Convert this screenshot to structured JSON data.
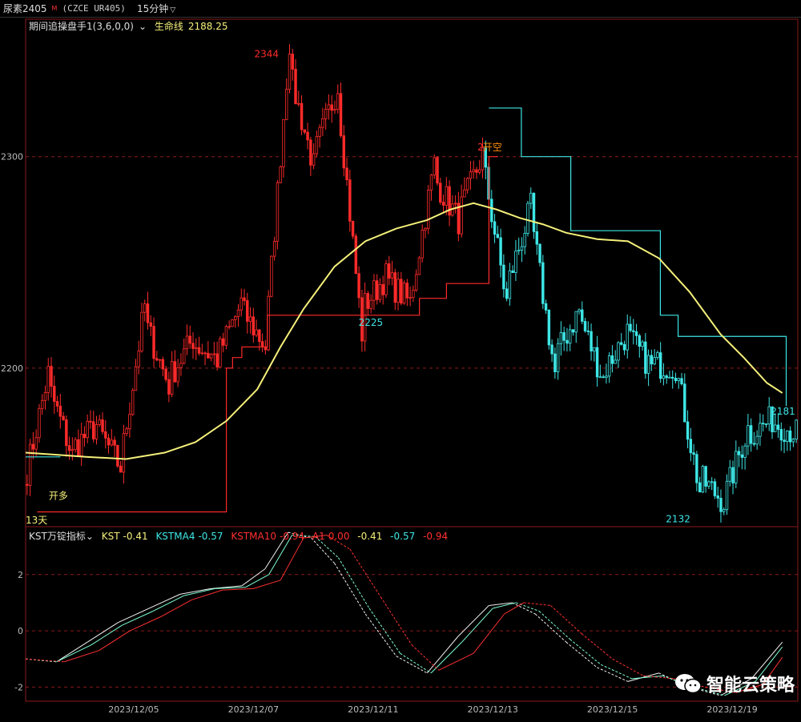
{
  "header": {
    "symbol": "尿素2405",
    "main_flag": "M",
    "code": "(CZCE UR405)",
    "period": "15分钟"
  },
  "main_legend": {
    "indicator": "期间追操盘手1(3,6,0,0)",
    "line_label": "生命线",
    "line_value": "2188.25"
  },
  "sub_legend": {
    "indicator": "KST万锭指标",
    "kst_label": "KST",
    "kst_value": "-0.41",
    "kstma4_label": "KSTMA4",
    "kstma4_value": "-0.57",
    "kstma10_label": "KSTMA10",
    "kstma10_value": "-0.94",
    "a1_label": "A1",
    "a1_value": "0.00",
    "v1": "-0.41",
    "v2": "-0.57",
    "v3": "-0.94"
  },
  "annotations": {
    "high": "2344",
    "mid_low": "2225",
    "peak2": "2",
    "open_short": "开空",
    "low": "2132",
    "last": "2181",
    "open_long": "开多",
    "days": "13天"
  },
  "watermark": "智能云策略",
  "colors": {
    "up": "#ff2a2a",
    "down": "#3ee6e6",
    "life_line": "#f5f07a",
    "kst": "#f0f0f0",
    "kstma4": "#7fffd4",
    "kstma10": "#ff3030",
    "grid": "#8b1a1a"
  },
  "chart_data": [
    {
      "type": "candlestick",
      "y_ticks": [
        2300,
        2200
      ],
      "ylim": [
        2125,
        2365
      ],
      "x_tick_labels": [
        "2023/12/05",
        "2023/12/07",
        "2023/12/11",
        "2023/12/13",
        "2023/12/15",
        "2023/12/19"
      ],
      "segments": [
        {
          "from": 2145,
          "to": 2192,
          "dir": "up"
        },
        {
          "from": 2192,
          "to": 2162,
          "dir": "up"
        },
        {
          "from": 2162,
          "to": 2172,
          "dir": "up"
        },
        {
          "from": 2172,
          "to": 2155,
          "dir": "up"
        },
        {
          "from": 2155,
          "to": 2222,
          "dir": "up"
        },
        {
          "from": 2222,
          "to": 2195,
          "dir": "up"
        },
        {
          "from": 2195,
          "to": 2212,
          "dir": "up"
        },
        {
          "from": 2212,
          "to": 2205,
          "dir": "up"
        },
        {
          "from": 2205,
          "to": 2228,
          "dir": "up"
        },
        {
          "from": 2228,
          "to": 2212,
          "dir": "up"
        },
        {
          "from": 2212,
          "to": 2340,
          "dir": "up"
        },
        {
          "from": 2340,
          "to": 2300,
          "dir": "up"
        },
        {
          "from": 2300,
          "to": 2330,
          "dir": "up"
        },
        {
          "from": 2330,
          "to": 2228,
          "dir": "up"
        },
        {
          "from": 2228,
          "to": 2242,
          "dir": "up"
        },
        {
          "from": 2242,
          "to": 2232,
          "dir": "up"
        },
        {
          "from": 2232,
          "to": 2290,
          "dir": "up"
        },
        {
          "from": 2290,
          "to": 2272,
          "dir": "up"
        },
        {
          "from": 2272,
          "to": 2298,
          "dir": "up"
        },
        {
          "from": 2298,
          "to": 2238,
          "dir": "down"
        },
        {
          "from": 2238,
          "to": 2272,
          "dir": "down"
        },
        {
          "from": 2272,
          "to": 2205,
          "dir": "down"
        },
        {
          "from": 2205,
          "to": 2225,
          "dir": "down"
        },
        {
          "from": 2225,
          "to": 2198,
          "dir": "down"
        },
        {
          "from": 2198,
          "to": 2215,
          "dir": "down"
        },
        {
          "from": 2215,
          "to": 2202,
          "dir": "down"
        },
        {
          "from": 2202,
          "to": 2201,
          "dir": "down"
        },
        {
          "from": 2201,
          "to": 2148,
          "dir": "down"
        },
        {
          "from": 2148,
          "to": 2138,
          "dir": "down"
        },
        {
          "from": 2138,
          "to": 2168,
          "dir": "down"
        },
        {
          "from": 2168,
          "to": 2175,
          "dir": "down"
        },
        {
          "from": 2175,
          "to": 2170,
          "dir": "down"
        }
      ],
      "life_line": [
        [
          0,
          2160
        ],
        [
          0.04,
          2159
        ],
        [
          0.08,
          2158
        ],
        [
          0.13,
          2157
        ],
        [
          0.18,
          2160
        ],
        [
          0.22,
          2165
        ],
        [
          0.26,
          2175
        ],
        [
          0.3,
          2190
        ],
        [
          0.33,
          2210
        ],
        [
          0.36,
          2228
        ],
        [
          0.4,
          2248
        ],
        [
          0.44,
          2260
        ],
        [
          0.48,
          2266
        ],
        [
          0.52,
          2270
        ],
        [
          0.55,
          2275
        ],
        [
          0.58,
          2278
        ],
        [
          0.61,
          2275
        ],
        [
          0.64,
          2271
        ],
        [
          0.67,
          2268
        ],
        [
          0.7,
          2264
        ],
        [
          0.74,
          2261
        ],
        [
          0.78,
          2260
        ],
        [
          0.82,
          2252
        ],
        [
          0.86,
          2236
        ],
        [
          0.9,
          2216
        ],
        [
          0.93,
          2205
        ],
        [
          0.96,
          2193
        ],
        [
          0.98,
          2188.25
        ]
      ],
      "red_step": [
        [
          0.015,
          2132
        ],
        [
          0.26,
          2132
        ],
        [
          0.26,
          2200
        ],
        [
          0.268,
          2200
        ],
        [
          0.268,
          2205
        ],
        [
          0.28,
          2205
        ],
        [
          0.28,
          2210
        ],
        [
          0.313,
          2210
        ],
        [
          0.313,
          2225
        ],
        [
          0.51,
          2225
        ],
        [
          0.51,
          2233
        ],
        [
          0.545,
          2233
        ],
        [
          0.545,
          2240
        ],
        [
          0.6,
          2240
        ],
        [
          0.6,
          2300
        ],
        [
          0.612,
          2300
        ]
      ],
      "cyan_step": [
        [
          0.6,
          2323
        ],
        [
          0.642,
          2323
        ],
        [
          0.642,
          2300
        ],
        [
          0.706,
          2300
        ],
        [
          0.706,
          2265
        ],
        [
          0.822,
          2265
        ],
        [
          0.822,
          2225
        ],
        [
          0.845,
          2225
        ],
        [
          0.845,
          2215
        ],
        [
          0.985,
          2215
        ],
        [
          0.985,
          2182
        ]
      ],
      "initial_cyan_step": [
        [
          0.0,
          2158
        ],
        [
          0.045,
          2158
        ]
      ]
    },
    {
      "type": "line",
      "y_ticks": [
        2,
        0,
        -2
      ],
      "ylim": [
        -2.5,
        3.7
      ],
      "series": [
        {
          "name": "KST",
          "values": [
            [
              0,
              -1.0
            ],
            [
              0.04,
              -1.1
            ],
            [
              0.08,
              -0.4
            ],
            [
              0.12,
              0.3
            ],
            [
              0.16,
              0.8
            ],
            [
              0.2,
              1.3
            ],
            [
              0.24,
              1.5
            ],
            [
              0.28,
              1.6
            ],
            [
              0.31,
              2.2
            ],
            [
              0.34,
              3.5
            ],
            [
              0.37,
              3.3
            ],
            [
              0.4,
              2.4
            ],
            [
              0.44,
              0.6
            ],
            [
              0.48,
              -0.9
            ],
            [
              0.52,
              -1.5
            ],
            [
              0.56,
              -0.2
            ],
            [
              0.6,
              0.9
            ],
            [
              0.63,
              1.0
            ],
            [
              0.66,
              0.6
            ],
            [
              0.7,
              -0.4
            ],
            [
              0.74,
              -1.3
            ],
            [
              0.78,
              -1.8
            ],
            [
              0.82,
              -1.5
            ],
            [
              0.86,
              -2.0
            ],
            [
              0.9,
              -2.3
            ],
            [
              0.94,
              -1.7
            ],
            [
              0.98,
              -0.4
            ]
          ]
        },
        {
          "name": "KSTMA4",
          "values": [
            [
              0,
              -1.0
            ],
            [
              0.04,
              -1.1
            ],
            [
              0.085,
              -0.5
            ],
            [
              0.125,
              0.2
            ],
            [
              0.165,
              0.7
            ],
            [
              0.205,
              1.25
            ],
            [
              0.245,
              1.5
            ],
            [
              0.285,
              1.55
            ],
            [
              0.315,
              2.0
            ],
            [
              0.345,
              3.4
            ],
            [
              0.375,
              3.35
            ],
            [
              0.405,
              2.6
            ],
            [
              0.445,
              0.8
            ],
            [
              0.485,
              -0.8
            ],
            [
              0.525,
              -1.5
            ],
            [
              0.565,
              -0.4
            ],
            [
              0.605,
              0.8
            ],
            [
              0.635,
              1.0
            ],
            [
              0.665,
              0.7
            ],
            [
              0.705,
              -0.3
            ],
            [
              0.745,
              -1.2
            ],
            [
              0.785,
              -1.7
            ],
            [
              0.825,
              -1.6
            ],
            [
              0.865,
              -2.0
            ],
            [
              0.905,
              -2.3
            ],
            [
              0.945,
              -1.8
            ],
            [
              0.98,
              -0.57
            ]
          ]
        },
        {
          "name": "KSTMA10",
          "values": [
            [
              0,
              -1.0
            ],
            [
              0.05,
              -1.1
            ],
            [
              0.095,
              -0.7
            ],
            [
              0.135,
              0.0
            ],
            [
              0.175,
              0.5
            ],
            [
              0.215,
              1.1
            ],
            [
              0.255,
              1.45
            ],
            [
              0.295,
              1.5
            ],
            [
              0.33,
              1.8
            ],
            [
              0.36,
              3.3
            ],
            [
              0.39,
              3.4
            ],
            [
              0.42,
              2.9
            ],
            [
              0.46,
              1.2
            ],
            [
              0.5,
              -0.5
            ],
            [
              0.535,
              -1.4
            ],
            [
              0.58,
              -0.8
            ],
            [
              0.62,
              0.6
            ],
            [
              0.645,
              1.0
            ],
            [
              0.68,
              0.9
            ],
            [
              0.72,
              -0.1
            ],
            [
              0.76,
              -1.0
            ],
            [
              0.8,
              -1.6
            ],
            [
              0.84,
              -1.7
            ],
            [
              0.88,
              -2.0
            ],
            [
              0.92,
              -2.2
            ],
            [
              0.955,
              -1.9
            ],
            [
              0.98,
              -0.94
            ]
          ]
        }
      ]
    }
  ]
}
